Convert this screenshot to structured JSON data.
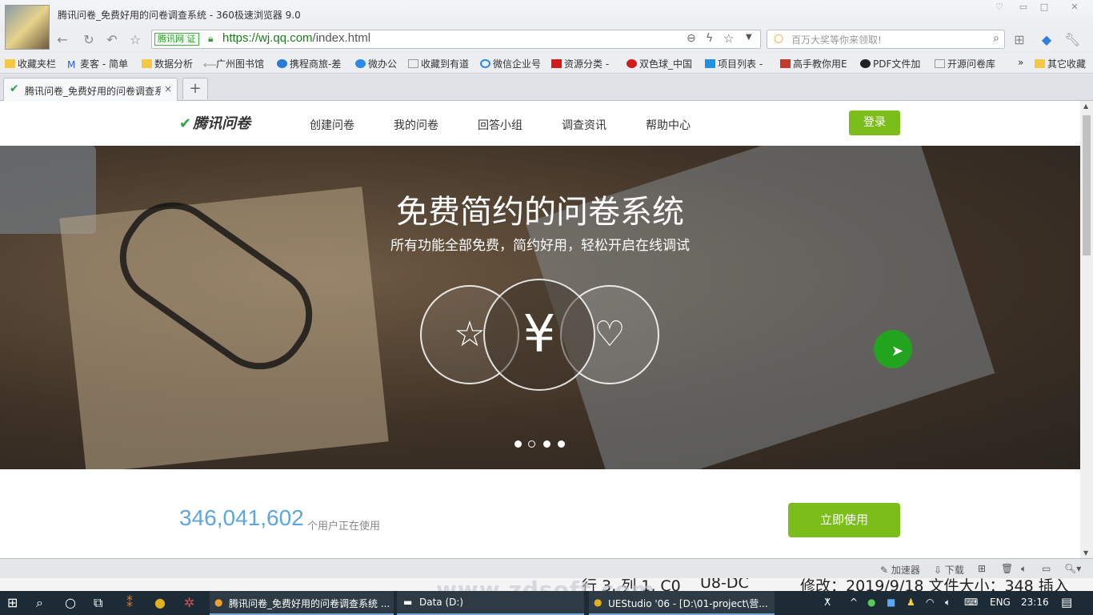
{
  "window": {
    "title": "腾讯问卷_免费好用的问卷调查系统 - 360极速浏览器 9.0"
  },
  "address": {
    "badge": "腾讯网",
    "badge_cert": "证",
    "url_host": "https://wj.qq.com",
    "url_path": "/index.html"
  },
  "search": {
    "placeholder": "百万大奖等你来领取!"
  },
  "bookmarks": [
    "收藏夹栏",
    "麦客 - 简单",
    "数据分析",
    "广州图书馆",
    "携程商旅-差",
    "微办公",
    "收藏到有道",
    "微信企业号",
    "资源分类 -",
    "双色球_中国",
    "项目列表 -",
    "高手教你用E",
    "PDF文件加",
    "开源问卷库"
  ],
  "bookmarks_more": "»",
  "bookmarks_other": "其它收藏",
  "tab": {
    "title": "腾讯问卷_免费好用的问卷调查系统",
    "close": "×",
    "new": "+"
  },
  "site": {
    "logo": "腾讯问卷",
    "nav": [
      "创建问卷",
      "我的问卷",
      "回答小组",
      "调查资讯",
      "帮助中心"
    ],
    "login": "登录",
    "hero_title": "免费简约的问卷系统",
    "hero_subtitle": "所有功能全部免费，简约好用，轻松开启在线调试",
    "carousel_active": 2,
    "user_count": "346,041,602",
    "user_count_label": "个用户正在使用",
    "cta": "立即使用",
    "accent": "#7bbd1a"
  },
  "statusbar": {
    "accelerator": "加速器",
    "download": "下载"
  },
  "editor_strip": {
    "pos": "行 3, 列 1, C0",
    "enc": "U8-DC",
    "info": "修改：2019/9/18 文件大小：348 插入"
  },
  "watermark": "www.zdsoft.com",
  "taskbar": {
    "tasks": [
      "腾讯问卷_免费好用的问卷调查系统 ...",
      "Data (D:)",
      "UEStudio '06 - [D:\\01-project\\营..."
    ],
    "lang": "ENG",
    "time": "23:16"
  }
}
